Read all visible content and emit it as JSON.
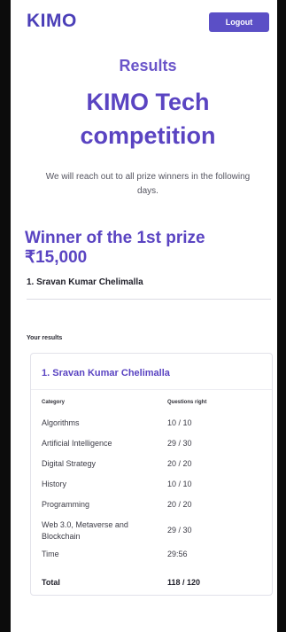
{
  "header": {
    "logo": "KIMO",
    "logout_label": "Logout"
  },
  "hero": {
    "results_label": "Results",
    "title_line1": "KIMO Tech",
    "title_line2": "competition",
    "intro": "We will reach out to all prize winners in the following days."
  },
  "prize": {
    "heading_line1": "Winner of the 1st prize",
    "amount": "₹15,000",
    "winner": "1.  Sravan Kumar Chelimalla"
  },
  "results": {
    "section_label": "Your results",
    "card_title": "1.  Sravan Kumar Chelimalla",
    "col_category": "Category",
    "col_questions": "Questions right",
    "rows": [
      {
        "category": "Algorithms",
        "value": "10 / 10"
      },
      {
        "category": "Artificial Intelligence",
        "value": "29 / 30"
      },
      {
        "category": "Digital Strategy",
        "value": "20 / 20"
      },
      {
        "category": "History",
        "value": "10 / 10"
      },
      {
        "category": "Programming",
        "value": "20 / 20"
      },
      {
        "category": "Web 3.0, Metaverse and Blockchain",
        "value": "29 / 30"
      },
      {
        "category": "Time",
        "value": "29:56"
      }
    ],
    "total_label": "Total",
    "total_value": "118 / 120"
  }
}
